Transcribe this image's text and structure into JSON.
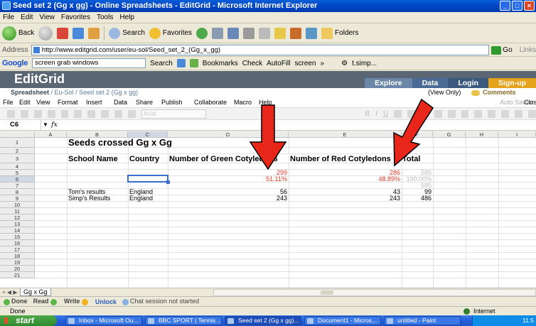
{
  "window": {
    "title": "Seed set 2 (Gg x gg) - Online Spreadsheets - EditGrid - Microsoft Internet Explorer"
  },
  "ie_menu": [
    "File",
    "Edit",
    "View",
    "Favorites",
    "Tools",
    "Help"
  ],
  "ie_toolbar": {
    "back": "Back",
    "search": "Search",
    "favorites": "Favorites",
    "folders": "Folders"
  },
  "address": {
    "label": "Address",
    "url": "http://www.editgrid.com/user/eu-sol/Seed_set_2_(Gg_x_gg)",
    "go": "Go",
    "links": "Links"
  },
  "google_bar": {
    "logo": "Google",
    "query": "screen grab windows",
    "search": "Search",
    "bookmarks": "Bookmarks",
    "check": "Check",
    "autofill": "AutoFill",
    "screen": "screen",
    "more": "»",
    "user": "t.simp..."
  },
  "editgrid": {
    "logo": "EditGrid",
    "nav": {
      "explore": "Explore",
      "data": "Data",
      "login": "Login",
      "signup": "Sign-up"
    },
    "breadcrumb": {
      "label": "Spreadsheet",
      "path": "/ Eu-Sol / Seed set 2 (Gg x gg)",
      "view_only": "(View Only)",
      "comments": "Comments"
    },
    "menu": [
      "File",
      "Edit",
      "View",
      "Format",
      "Insert",
      "Data",
      "Share",
      "Publish",
      "Collaborate",
      "Macro",
      "Help"
    ],
    "auto_saved": "Auto Saved",
    "close": "Close",
    "font_name": "Arial",
    "cell_ref": "C6",
    "fx": "fx"
  },
  "grid": {
    "columns": [
      "A",
      "B",
      "C",
      "D",
      "E",
      "F",
      "G",
      "H",
      "I"
    ],
    "rows": [
      "1",
      "2",
      "3",
      "4",
      "5",
      "6",
      "7",
      "8",
      "9",
      "10",
      "11",
      "12",
      "13",
      "14",
      "15",
      "16",
      "17",
      "18",
      "19",
      "20",
      "21"
    ],
    "title": "Seeds crossed Gg x Gg",
    "headers": {
      "school": "School Name",
      "country": "Country",
      "green": "Number of Green Cotyledons",
      "red": "Number of Red Cotyledons",
      "total": "Total"
    },
    "row5": {
      "green": "299",
      "red": "286",
      "total": "585"
    },
    "row6": {
      "green": "51.11%",
      "red": "48.89%",
      "total": "100.00%"
    },
    "row7": {
      "total": "585"
    },
    "data_rows": [
      {
        "school": "Tom's results",
        "country": "England",
        "green": "56",
        "red": "43",
        "total": "99"
      },
      {
        "school": "Simp's Results",
        "country": "England",
        "green": "243",
        "red": "243",
        "total": "486"
      }
    ]
  },
  "sheet_tab": "Gg x Gg",
  "chat": {
    "done": "Done",
    "read": "Read",
    "write": "Write",
    "unlock": "Unlock",
    "chat": "Chat session not started"
  },
  "ie_status": {
    "text": "Done",
    "zone": "Internet"
  },
  "taskbar": {
    "start": "start",
    "tasks": [
      "Inbox - Microsoft Ou...",
      "BBC SPORT | Tennis ...",
      "Seed set 2 (Gg x gg)...",
      "Document1 - Micros...",
      "untitled - Paint"
    ],
    "clock": "11:5"
  },
  "colors": {
    "arrow": "#e8261a",
    "highlight_text": "#e03a2a",
    "selection": "#3a6fd0",
    "editgrid_header": "#5a6674",
    "signup": "#e4a31a"
  }
}
